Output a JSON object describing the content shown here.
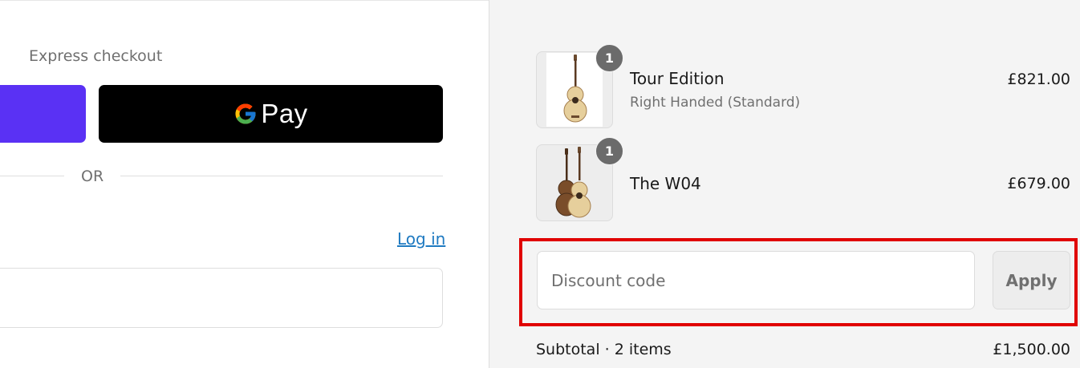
{
  "checkout": {
    "express_label": "Express checkout",
    "gpay_label": "Pay",
    "or_label": "OR",
    "login_link": "Log in"
  },
  "order": {
    "items": [
      {
        "name": "Tour Edition",
        "variant": "Right Handed (Standard)",
        "price": "£821.00",
        "quantity": "1"
      },
      {
        "name": "The W04",
        "variant": "",
        "price": "£679.00",
        "quantity": "1"
      }
    ],
    "discount": {
      "placeholder": "Discount code",
      "apply_label": "Apply"
    },
    "subtotal": {
      "label": "Subtotal · 2 items",
      "value": "£1,500.00"
    }
  },
  "colors": {
    "shop_pay": "#5a31f4",
    "gpay_bg": "#000000",
    "link": "#1f7ac1",
    "highlight": "#e00000",
    "sidebar_bg": "#f4f4f4"
  }
}
